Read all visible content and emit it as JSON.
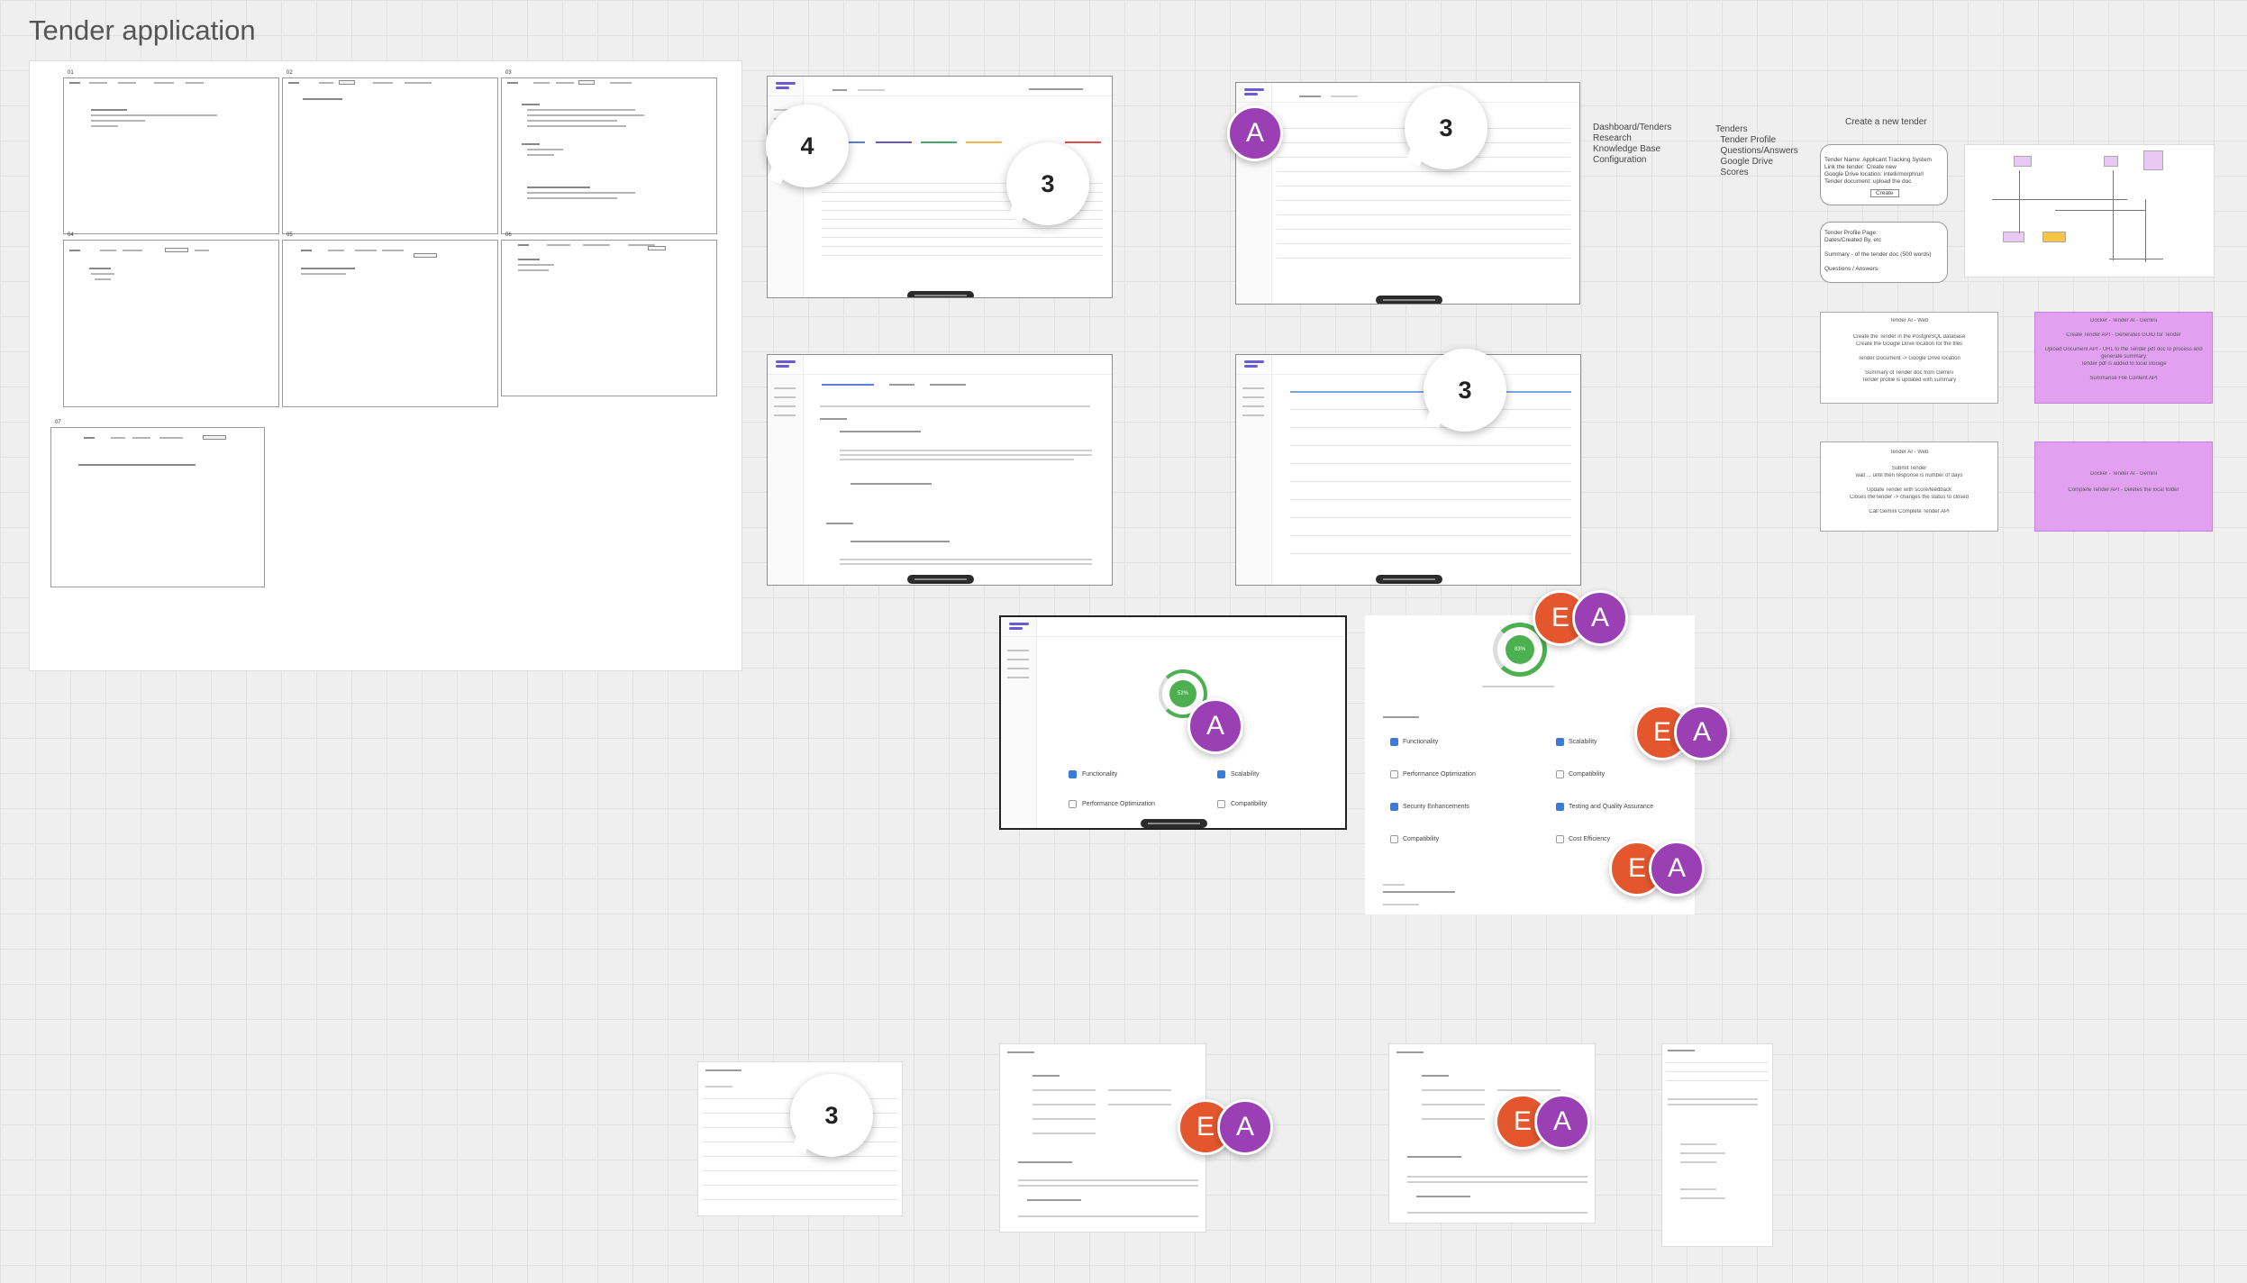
{
  "board": {
    "title": "Tender application"
  },
  "wireframes": {
    "labels": [
      "01",
      "02",
      "03",
      "04",
      "05",
      "06",
      "07"
    ]
  },
  "counters": {
    "c1": "4",
    "c2": "3",
    "c3": "3",
    "c4": "3",
    "c5": "3"
  },
  "avatars": {
    "a": "A",
    "e": "E"
  },
  "score_shots": {
    "percent_small": "52%",
    "percent_large": "83%",
    "small_checks": [
      {
        "label": "Functionality",
        "checked": true
      },
      {
        "label": "Scalability",
        "checked": true
      },
      {
        "label": "Performance Optimization",
        "checked": false
      },
      {
        "label": "Compatibility",
        "checked": false
      }
    ],
    "large_checks": [
      {
        "label": "Functionality",
        "checked": true
      },
      {
        "label": "Scalability",
        "checked": true
      },
      {
        "label": "Performance Optimization",
        "checked": false
      },
      {
        "label": "Compatibility",
        "checked": false
      },
      {
        "label": "Security Enhancements",
        "checked": true
      },
      {
        "label": "Testing and Quality Assurance",
        "checked": true
      },
      {
        "label": "Compatibility",
        "checked": false
      },
      {
        "label": "Cost Efficiency",
        "checked": false
      }
    ]
  },
  "notes": {
    "nav_list": "Dashboard/Tenders\nResearch\nKnowledge Base\nConfiguration",
    "tender_pages": "Tenders\n  Tender Profile\n  Questions/Answers\n  Google Drive\n  Scores",
    "create_title": "Create a new tender"
  },
  "create_form": {
    "lines": [
      "Tender Name: Applicant Tracking System",
      "Link the tender: Create new",
      "Google Drive location: intelli/morph/url",
      "Tender document: upload the doc"
    ],
    "button": "Create"
  },
  "profile_box": {
    "lines": [
      "Tender Profile Page:",
      "Dates/Created By, etc",
      "",
      "Summary - of the tender doc (500 words)",
      "",
      "Questions / Answers"
    ]
  },
  "web_box_1": {
    "lines": [
      "Tender AI - Web",
      "",
      "Create the Tender in the PostgreSQL database",
      "Create the Google Drive location for the files",
      "",
      "Tender Document -> Google Drive location",
      "",
      "Summary of Tender doc from Gemini",
      "Tender profile is updated with summary"
    ]
  },
  "docker_box_1": {
    "lines": [
      "Docker - Tender AI - Gemini",
      "",
      "Create Tender API - Generates GUID for Tender",
      "",
      "Upload Document API - URL to the Tender pdf doc to process and",
      "generate summary",
      "Tender pdf is added to local storage",
      "",
      "Summarise File Content API"
    ]
  },
  "web_box_2": {
    "lines": [
      "Tender AI - Web",
      "",
      "Submit Tender",
      "wait ... until then response is number of days",
      "",
      "Update Tender with score/feedback",
      "Closes the tender -> changes the status to closed",
      "",
      "Call Gemini Complete Tender API"
    ]
  },
  "docker_box_2": {
    "lines": [
      "Docker - Tender AI - Gemini",
      "",
      "Complete Tender API - Deletes the local folder"
    ]
  }
}
